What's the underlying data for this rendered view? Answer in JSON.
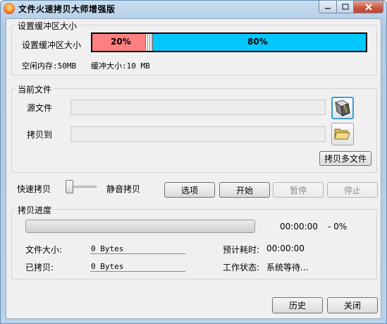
{
  "window": {
    "title": "文件火速拷贝大师增强版",
    "min_icon": "minimize-icon",
    "max_icon": "maximize-icon",
    "close_icon": "close-icon"
  },
  "buffer_group": {
    "label": "设置缓冲区大小",
    "row_label": "设置缓冲区大小",
    "left_percent": "20%",
    "right_percent": "80%",
    "left_color": "#ff8080",
    "right_color": "#00c8ff",
    "free_memory": "空闲内存:50MB",
    "buffer_size": "缓冲大小:10 MB"
  },
  "file_group": {
    "label": "当前文件",
    "source_label": "源文件",
    "source_value": "",
    "dest_label": "拷贝到",
    "dest_value": "",
    "source_icon": "file-open-icon",
    "dest_icon": "folder-icon",
    "multi_copy_button": "拷贝多文件"
  },
  "mode": {
    "fast_label": "快速拷贝",
    "quiet_label": "静音拷贝",
    "slider_level": 0,
    "options_button": "选项",
    "start_button": "开始",
    "pause_button": "暂停",
    "stop_button": "停止"
  },
  "progress_group": {
    "label": "拷贝进度",
    "progress": 0,
    "elapsed": "00:00:00",
    "percent": "- 0%",
    "file_size_label": "文件大小:",
    "file_size_value": "0 Bytes",
    "copied_label": "已拷贝:",
    "copied_value": "0 Bytes",
    "estimate_label": "预计耗时:",
    "estimate_value": "00:00:00",
    "status_label": "工作状态:",
    "status_value": "系统等待..."
  },
  "footer": {
    "history_button": "历史",
    "close_button": "关闭"
  }
}
